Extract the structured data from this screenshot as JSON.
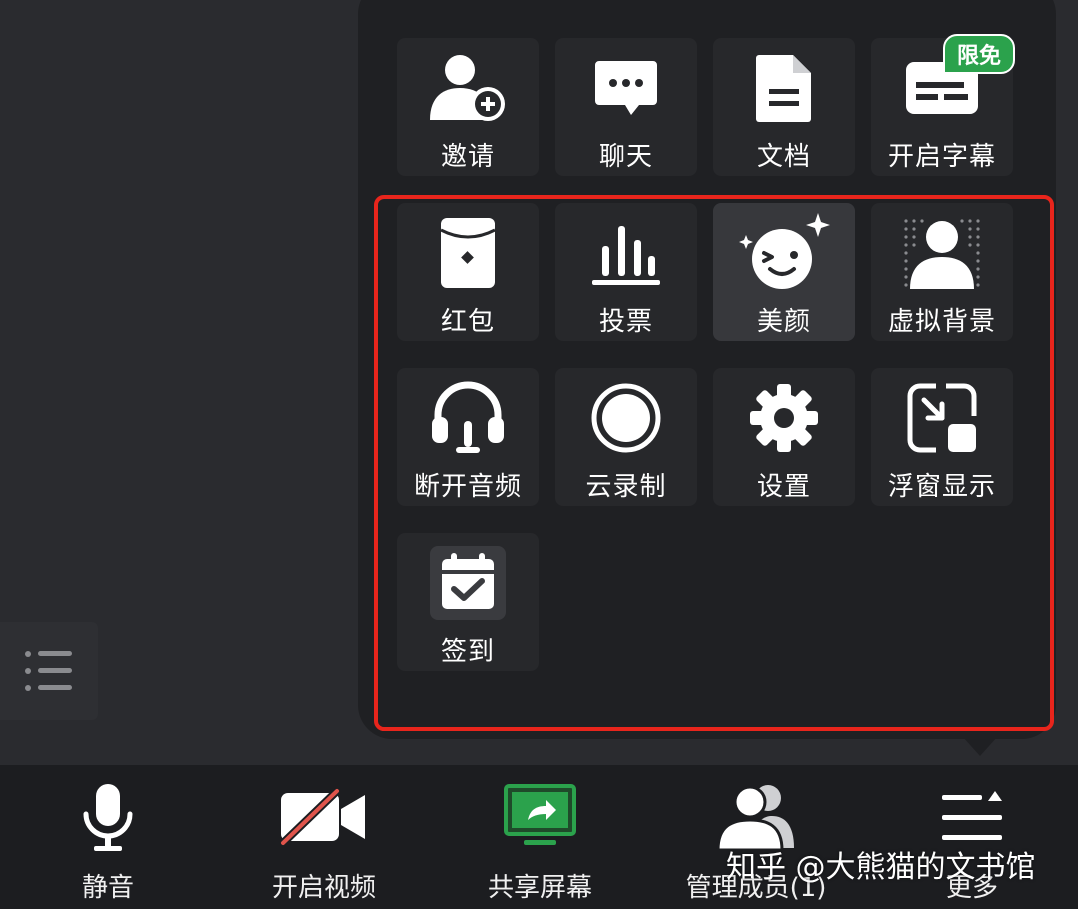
{
  "more_panel": {
    "tiles": [
      {
        "label": "邀请",
        "icon": "invite-user-icon"
      },
      {
        "label": "聊天",
        "icon": "chat-icon"
      },
      {
        "label": "文档",
        "icon": "document-icon"
      },
      {
        "label": "开启字幕",
        "icon": "caption-icon",
        "badge": "限免"
      },
      {
        "label": "红包",
        "icon": "red-packet-icon"
      },
      {
        "label": "投票",
        "icon": "vote-icon"
      },
      {
        "label": "美颜",
        "icon": "beauty-icon"
      },
      {
        "label": "虚拟背景",
        "icon": "virtual-background-icon"
      },
      {
        "label": "断开音频",
        "icon": "headphones-icon"
      },
      {
        "label": "云录制",
        "icon": "cloud-record-icon"
      },
      {
        "label": "设置",
        "icon": "gear-icon"
      },
      {
        "label": "浮窗显示",
        "icon": "floating-window-icon"
      },
      {
        "label": "签到",
        "icon": "check-in-icon"
      }
    ]
  },
  "toolbar": {
    "items": [
      {
        "label": "静音",
        "icon": "microphone-icon"
      },
      {
        "label": "开启视频",
        "icon": "video-off-icon"
      },
      {
        "label": "共享屏幕",
        "icon": "share-screen-icon"
      },
      {
        "label": "管理成员(1)",
        "icon": "members-icon"
      },
      {
        "label": "更多",
        "icon": "more-menu-icon"
      }
    ]
  },
  "watermark": "知乎 @大熊猫的文书馆",
  "colors": {
    "background": "#2a2b2f",
    "panel": "#1f2023",
    "tile": "#27282b",
    "highlight_border": "#e8251c",
    "badge": "#2ba24c",
    "share_screen": "#2ba24c",
    "video_off_slash": "#e0544b"
  }
}
